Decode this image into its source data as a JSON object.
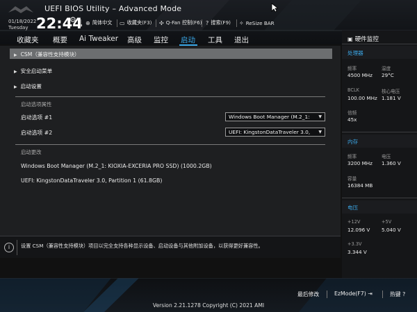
{
  "header": {
    "app_title": "UEFI BIOS Utility – Advanced Mode",
    "date": "01/18/2022",
    "day": "Tuesday",
    "time": "22:44",
    "tools": [
      {
        "icon": "globe-icon",
        "glyph": "⊕",
        "label": "简体中文"
      },
      {
        "icon": "bookmark-icon",
        "glyph": "▭",
        "label": "收藏夹(F3)"
      },
      {
        "icon": "fan-icon",
        "glyph": "✣",
        "label": "Q-Fan 控制(F6)"
      },
      {
        "icon": "help-icon",
        "glyph": "?",
        "label": "搜索(F9)"
      },
      {
        "icon": "resize-bar-icon",
        "glyph": "✧",
        "label": "ReSize BAR"
      }
    ]
  },
  "tabs": [
    {
      "label": "收藏夹",
      "active": false
    },
    {
      "label": "概要",
      "active": false
    },
    {
      "label": "Ai Tweaker",
      "active": false
    },
    {
      "label": "高级",
      "active": false
    },
    {
      "label": "监控",
      "active": false
    },
    {
      "label": "启动",
      "active": true
    },
    {
      "label": "工具",
      "active": false
    },
    {
      "label": "退出",
      "active": false
    }
  ],
  "main": {
    "menu": [
      {
        "label": "CSM（兼容性支持模块）",
        "selected": true
      },
      {
        "label": "安全启动菜单",
        "selected": false
      },
      {
        "label": "启动设置",
        "selected": false
      }
    ],
    "boot_priority_heading": "启动选项属性",
    "boot_options": [
      {
        "label": "启动选项 #1",
        "value": "Windows Boot Manager (M.2_1:"
      },
      {
        "label": "启动选项 #2",
        "value": "UEFI: KingstonDataTraveler 3.0,"
      }
    ],
    "boot_override_heading": "启动更改",
    "override_devices": [
      "Windows Boot Manager (M.2_1: KIOXIA-EXCERIA PRO SSD) (1000.2GB)",
      "UEFI: KingstonDataTraveler 3.0, Partition 1 (61.8GB)"
    ]
  },
  "info_text": "设置 CSM（兼容性支持模块）项目以完全支持各种显示设备、启动设备与其他附加设备，以获得更好兼容性。",
  "monitor": {
    "title": "硬件监控",
    "cpu": {
      "heading": "处理器",
      "freq_label": "频率",
      "freq": "4500 MHz",
      "temp_label": "温度",
      "temp": "29°C",
      "bclk_label": "BCLK",
      "bclk": "100.00 MHz",
      "core_v_label": "核心电压",
      "core_v": "1.181 V",
      "ratio_label": "倍频",
      "ratio": "45x"
    },
    "memory": {
      "heading": "内存",
      "freq_label": "频率",
      "freq": "3200 MHz",
      "volt_label": "电压",
      "volt": "1.360 V",
      "cap_label": "容量",
      "cap": "16384 MB"
    },
    "voltage": {
      "heading": "电压",
      "v12_label": "+12V",
      "v12": "12.096 V",
      "v5_label": "+5V",
      "v5": "5.040 V",
      "v33_label": "+3.3V",
      "v33": "3.344 V"
    }
  },
  "footer": {
    "last_modified": "最后修改",
    "ezmode": "EzMode(F7)",
    "hotkeys": "热键",
    "version": "Version 2.21.1278 Copyright (C) 2021 AMI"
  },
  "colors": {
    "accent": "#3ba8e8",
    "highlight_row": "#6c6e70",
    "panel_bg": "#1e1f21"
  }
}
